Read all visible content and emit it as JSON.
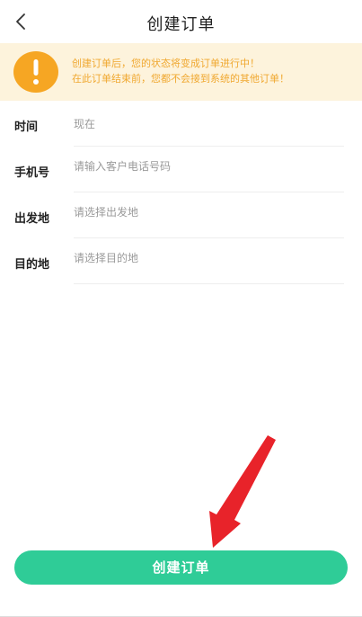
{
  "header": {
    "title": "创建订单",
    "back_icon": "chevron-left-icon"
  },
  "notice": {
    "icon": "exclamation-icon",
    "line1": "创建订单后，您的状态将变成订单进行中！",
    "line2": "在此订单结束前，您都不会接到系统的其他订单！",
    "color": "#f0a830",
    "background": "#fdf3dc"
  },
  "form": {
    "time": {
      "label": "时间",
      "value": "现在"
    },
    "phone": {
      "label": "手机号",
      "placeholder": "请输入客户电话号码"
    },
    "origin": {
      "label": "出发地",
      "placeholder": "请选择出发地"
    },
    "destination": {
      "label": "目的地",
      "placeholder": "请选择目的地"
    }
  },
  "submit": {
    "label": "创建订单",
    "color": "#2fcc97"
  },
  "annotation": {
    "arrow_color": "#e8232a"
  }
}
